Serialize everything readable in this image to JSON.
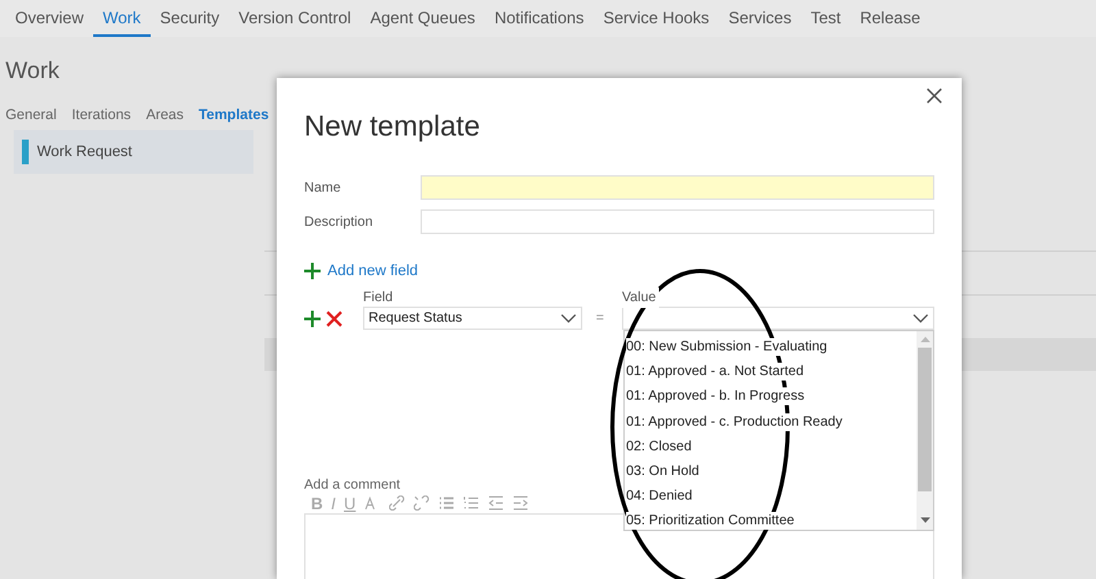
{
  "nav_tabs": [
    {
      "label": "Overview",
      "selected": false
    },
    {
      "label": "Work",
      "selected": true
    },
    {
      "label": "Security",
      "selected": false
    },
    {
      "label": "Version Control",
      "selected": false
    },
    {
      "label": "Agent Queues",
      "selected": false
    },
    {
      "label": "Notifications",
      "selected": false
    },
    {
      "label": "Service Hooks",
      "selected": false
    },
    {
      "label": "Services",
      "selected": false
    },
    {
      "label": "Test",
      "selected": false
    },
    {
      "label": "Release",
      "selected": false
    }
  ],
  "page_title": "Work",
  "sub_tabs": [
    {
      "label": "General",
      "selected": false
    },
    {
      "label": "Iterations",
      "selected": false
    },
    {
      "label": "Areas",
      "selected": false
    },
    {
      "label": "Templates",
      "selected": true
    }
  ],
  "sidebar": {
    "items": [
      {
        "label": "Work Request",
        "selected": true
      }
    ]
  },
  "dialog": {
    "title": "New template",
    "fields": [
      {
        "label": "Name",
        "required": true
      },
      {
        "label": "Description",
        "required": false
      }
    ],
    "add_field_link": "Add new field",
    "field_row": {
      "field_label": "Field",
      "field_value": "Request Status",
      "operator": "=",
      "value_label": "Value",
      "options": [
        "00: New Submission - Evaluating",
        "01: Approved - a. Not Started",
        "01: Approved - b. In Progress",
        "01: Approved - c. Production Ready",
        "02: Closed",
        "03: On Hold",
        "04: Denied",
        "05: Prioritization Committee"
      ]
    },
    "comment_label": "Add a comment",
    "toolbar_letters": [
      "B",
      "I",
      "U"
    ]
  }
}
